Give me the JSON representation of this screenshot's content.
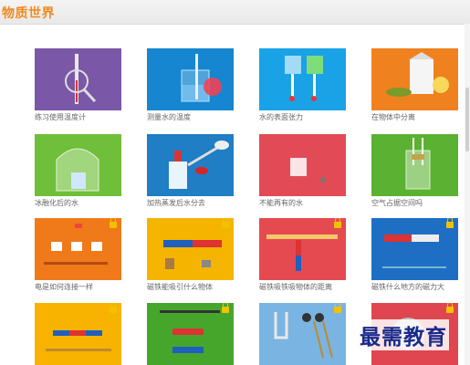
{
  "app": {
    "title": "物质世界",
    "watermark": "最需教育"
  },
  "experiments": [
    {
      "label": "练习使用温度计",
      "color": "#7b57a8",
      "icon": "thermometer-magnifier-icon",
      "locked": false
    },
    {
      "label": "测量水的温度",
      "color": "#1586cf",
      "icon": "beaker-thermometer-icon",
      "locked": false
    },
    {
      "label": "水的表面张力",
      "color": "#1aa2e6",
      "icon": "water-cups-icon",
      "locked": false
    },
    {
      "label": "在物体中分离",
      "color": "#f0811f",
      "icon": "milk-carton-icon",
      "locked": false
    },
    {
      "label": "冰融化后的水",
      "color": "#6fbf3a",
      "icon": "bell-jar-icon",
      "locked": false
    },
    {
      "label": "加热蒸发后水分去",
      "color": "#1f7ec4",
      "icon": "alcohol-lamp-spoon-icon",
      "locked": false
    },
    {
      "label": "不能再有的水",
      "color": "#e24b55",
      "icon": "small-beaker-icon",
      "locked": false
    },
    {
      "label": "空气占据空间吗",
      "color": "#5bb131",
      "icon": "glass-straws-icon",
      "locked": false
    },
    {
      "label": "电是如何连接一样",
      "color": "#f07a1a",
      "icon": "circuit-batteries-icon",
      "locked": true
    },
    {
      "label": "磁铁能吸引什么物体",
      "color": "#f4b400",
      "icon": "magnet-objects-icon",
      "locked": true
    },
    {
      "label": "磁铁吸铁吸物体的距离",
      "color": "#e54a51",
      "icon": "ruler-magnet-icon",
      "locked": true
    },
    {
      "label": "磁铁什么地方的磁力大",
      "color": "#1e6fc4",
      "icon": "bar-magnet-icon",
      "locked": true
    },
    {
      "label": "",
      "color": "#f7b300",
      "icon": "stacked-magnets-icon",
      "locked": true
    },
    {
      "label": "",
      "color": "#46a62c",
      "icon": "hanging-magnets-icon",
      "locked": true
    },
    {
      "label": "",
      "color": "#7ab4e2",
      "icon": "tuning-forks-icon",
      "locked": true
    },
    {
      "label": "",
      "color": "#e0464f",
      "icon": "sound-bowl-icon",
      "locked": true
    }
  ]
}
